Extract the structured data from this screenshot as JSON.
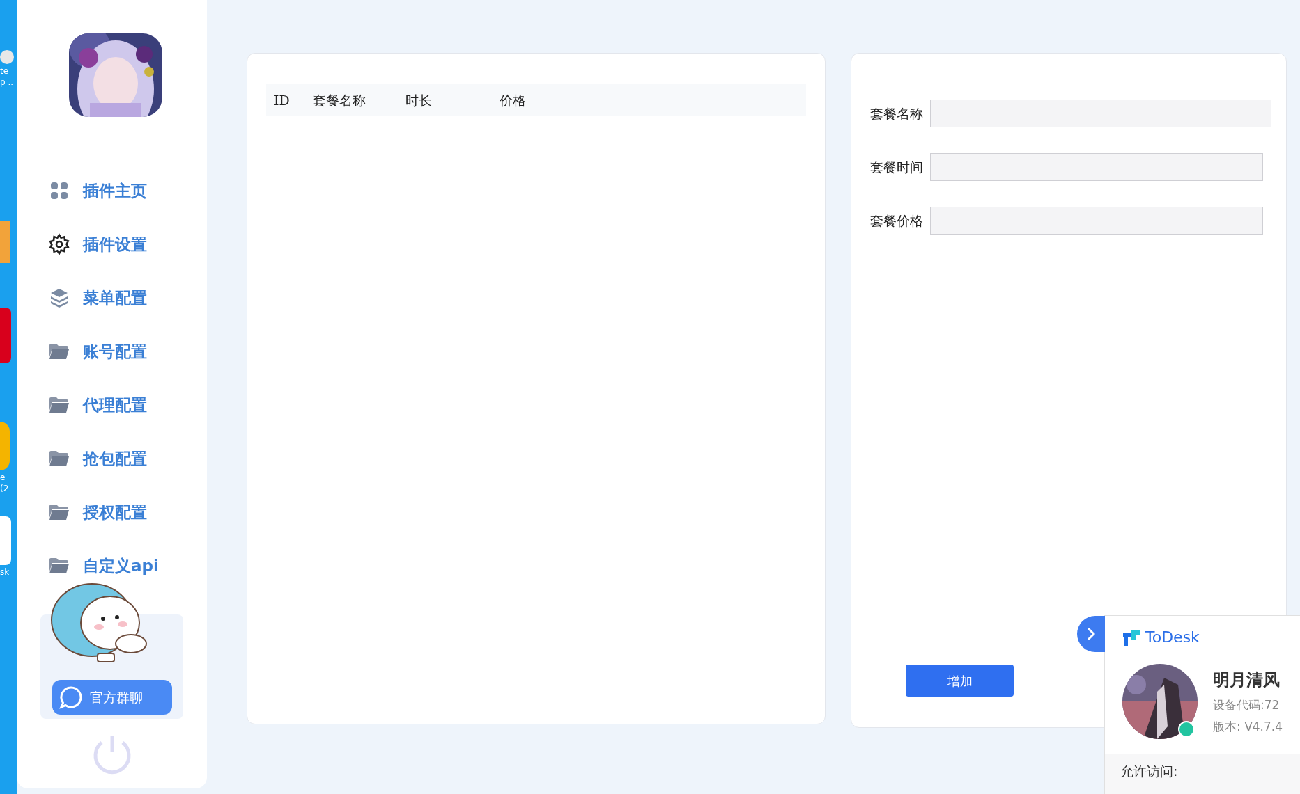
{
  "desktop_labels": [
    {
      "text": "te"
    },
    {
      "text": "p .."
    },
    {
      "text": "e"
    },
    {
      "text": "(2"
    },
    {
      "text": "sk"
    }
  ],
  "sidebar": {
    "items": [
      {
        "label": "插件主页",
        "kind": "grid"
      },
      {
        "label": "插件设置",
        "kind": "gear"
      },
      {
        "label": "菜单配置",
        "kind": "layers"
      },
      {
        "label": "账号配置",
        "kind": "folder"
      },
      {
        "label": "代理配置",
        "kind": "folder"
      },
      {
        "label": "抢包配置",
        "kind": "folder"
      },
      {
        "label": "授权配置",
        "kind": "folder"
      },
      {
        "label": "自定义api",
        "kind": "folder"
      }
    ],
    "group_chat_button": "官方群聊"
  },
  "table": {
    "columns": [
      "ID",
      "套餐名称",
      "时长",
      "价格"
    ]
  },
  "form": {
    "fields": [
      {
        "label": "套餐名称"
      },
      {
        "label": "套餐时间"
      },
      {
        "label": "套餐价格"
      }
    ],
    "submit": "增加"
  },
  "todesk": {
    "brand": "ToDesk",
    "user": "明月清风",
    "device_code": "设备代码:72",
    "version": "版本: V4.7.4",
    "access": "允许访问:"
  }
}
